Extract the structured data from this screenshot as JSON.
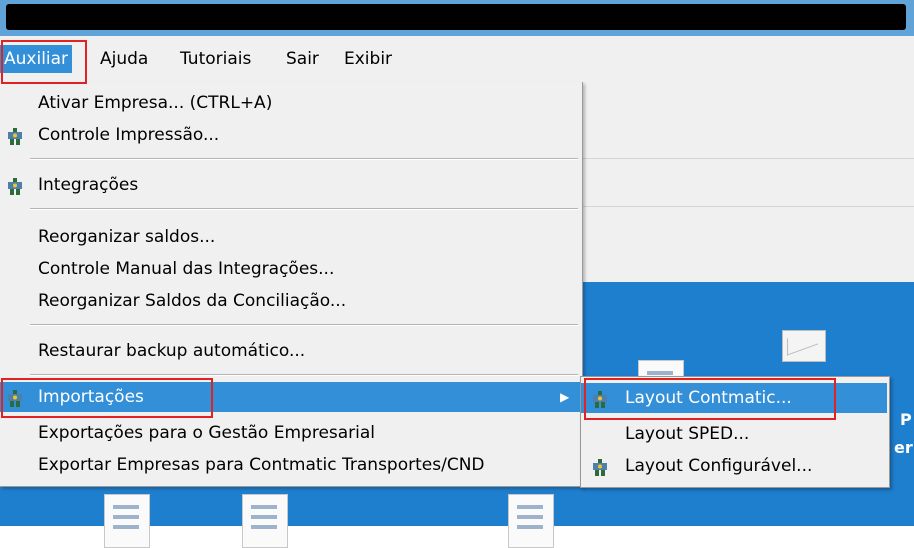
{
  "menubar": {
    "items": [
      {
        "label": "Auxiliar",
        "active": true
      },
      {
        "label": "Ajuda"
      },
      {
        "label": "Tutoriais"
      },
      {
        "label": "Sair"
      },
      {
        "label": "Exibir"
      }
    ]
  },
  "dropdown": {
    "groups": [
      [
        {
          "label": "Ativar Empresa... (CTRL+A)",
          "icon": ""
        },
        {
          "label": "Controle Impressão...",
          "icon": "contmatic-icon"
        }
      ],
      [
        {
          "label": "Integrações",
          "icon": "contmatic-icon"
        }
      ],
      [
        {
          "label": "Reorganizar saldos...",
          "icon": ""
        },
        {
          "label": "Controle Manual das Integrações...",
          "icon": ""
        },
        {
          "label": "Reorganizar Saldos da Conciliação...",
          "icon": ""
        }
      ],
      [
        {
          "label": "Restaurar backup automático...",
          "icon": ""
        }
      ],
      [
        {
          "label": "Importações",
          "icon": "contmatic-icon",
          "selected": true,
          "has_submenu": true
        },
        {
          "label": "Exportações para o Gestão Empresarial",
          "icon": ""
        },
        {
          "label": "Exportar Empresas para Contmatic Transportes/CND",
          "icon": ""
        }
      ]
    ]
  },
  "submenu": {
    "items": [
      {
        "label": "Layout Contmatic...",
        "icon": "contmatic-icon",
        "selected": true
      },
      {
        "label": "Layout SPED...",
        "icon": ""
      },
      {
        "label": "Layout Configurável...",
        "icon": "contmatic-icon"
      }
    ]
  },
  "desktop": {
    "partial_labels": [
      "P",
      "er"
    ]
  },
  "colors": {
    "highlight": "#3390d8",
    "annotation_box": "#e02222",
    "desktop": "#1f7fcf"
  }
}
